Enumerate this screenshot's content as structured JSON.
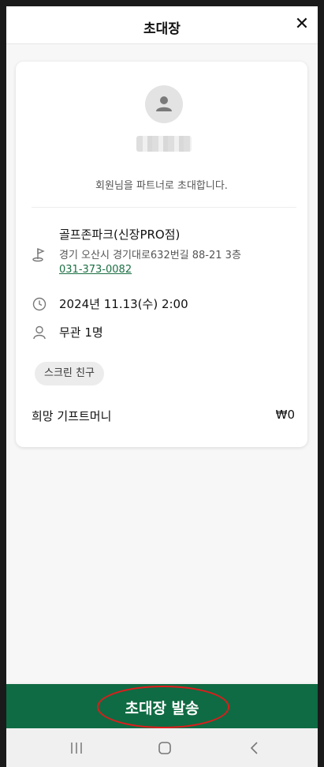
{
  "header": {
    "title": "초대장",
    "close_glyph": "✕"
  },
  "card": {
    "invite_message": "회원님을 파트너로 초대합니다.",
    "store": {
      "name": "골프존파크(신장PRO점)",
      "address": "경기 오산시 경기대로632번길 88-21 3층",
      "phone": "031-373-0082"
    },
    "datetime": "2024년 11.13(수) 2:00",
    "guests": "무관 1명",
    "tag": "스크린 친구",
    "gift_label": "희망 기프트머니",
    "gift_value": "₩0"
  },
  "footer": {
    "send_label": "초대장 발송"
  },
  "icons": {
    "avatar": "person-icon",
    "store": "golf-flag-icon",
    "time": "clock-icon",
    "guests": "person-outline-icon"
  },
  "colors": {
    "accent": "#0f6b43",
    "annotation": "#e01b1b",
    "link": "#1b6f43"
  }
}
